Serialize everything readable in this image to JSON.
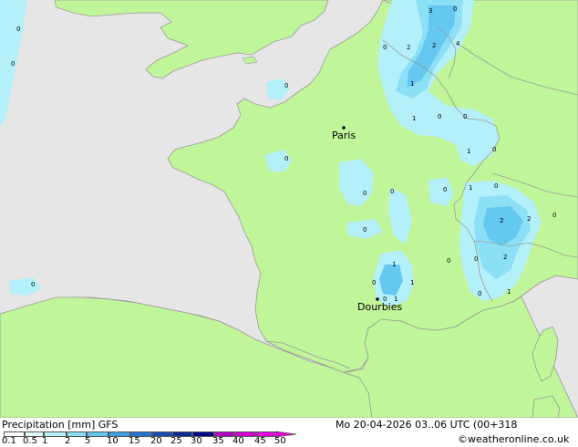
{
  "colors": {
    "sea": "#e6e6e6",
    "land": "#c0f59a",
    "border": "#a0a0a0",
    "coast": "#999999"
  },
  "cities": [
    {
      "name": "Paris"
    },
    {
      "name": "Dourbies"
    }
  ],
  "contour_labels": [
    "0",
    "0",
    "0",
    "0",
    "0",
    "3",
    "0",
    "0",
    "2",
    "2",
    "4",
    "1",
    "0",
    "1",
    "0",
    "0",
    "1",
    "0",
    "0",
    "0",
    "0",
    "1",
    "0",
    "2",
    "2",
    "0",
    "2",
    "0",
    "0",
    "1",
    "0",
    "1",
    "1",
    "0",
    "1",
    "0"
  ],
  "footer": {
    "title": "Precipitation [mm] GFS",
    "datetime": "Mo 20-04-2026 03..06 UTC (00+318",
    "credit": "©weatheronline.co.uk"
  },
  "legend": {
    "ticks": [
      "0.1",
      "0.5",
      "1",
      "2",
      "5",
      "10",
      "15",
      "20",
      "25",
      "30",
      "35",
      "40",
      "45",
      "50"
    ],
    "colors": [
      "#ffffff",
      "#e0fcff",
      "#b4f0fa",
      "#8ce0f5",
      "#64c8f0",
      "#3ca0e6",
      "#1e78d2",
      "#1450b4",
      "#0a2896",
      "#00008c",
      "#b400c8",
      "#d200d2",
      "#e600e6",
      "#f000dc",
      "#c8c8c8"
    ]
  }
}
